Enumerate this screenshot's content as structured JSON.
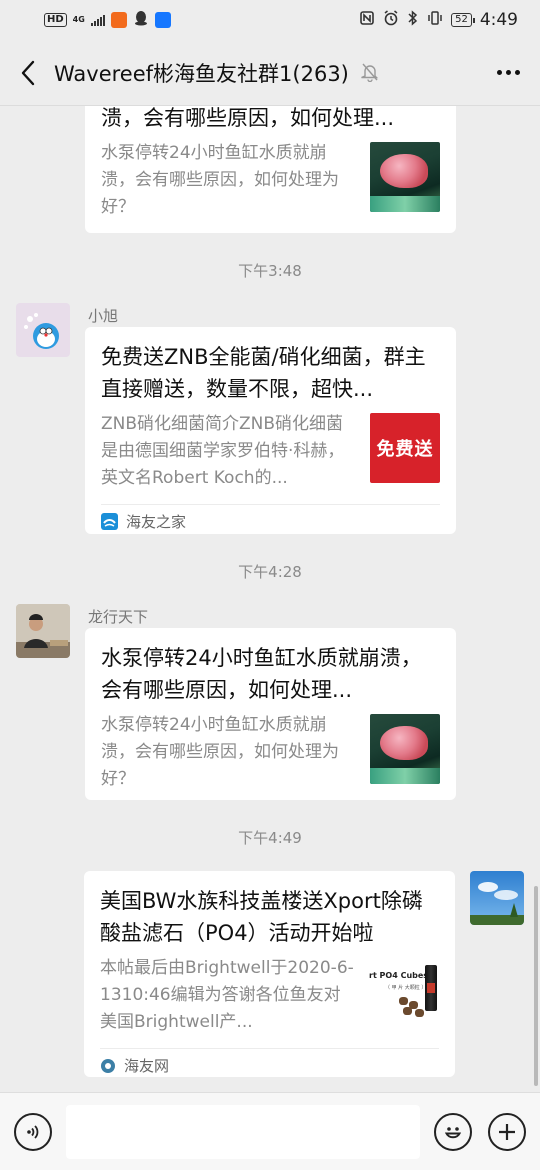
{
  "status_bar": {
    "network_badge": "HD",
    "network_type": "4G",
    "battery_level": "52",
    "time": "4:49",
    "icons": [
      "hd-icon",
      "signal-icon",
      "taobao-icon",
      "qq-icon",
      "alipay-icon",
      "nfc-icon",
      "alarm-icon",
      "bluetooth-icon",
      "vibrate-icon",
      "battery-icon"
    ]
  },
  "header": {
    "title": "Wavereef彬海鱼友社群1(263)",
    "muted": true,
    "back_icon": "chevron-left-icon",
    "more_icon": "more-dots-icon"
  },
  "messages": [
    {
      "type": "link_card",
      "title": "溃，会有哪些原因，如何处理...",
      "desc": "水泵停转24小时鱼缸水质就崩溃，会有哪些原因，如何处理为好？",
      "thumb": "fish-thumbnail"
    },
    {
      "type": "timestamp",
      "text": "下午3:48"
    },
    {
      "type": "link_card",
      "sender": "小旭",
      "avatar": "doraemon-avatar",
      "title": "免费送ZNB全能菌/硝化细菌，群主直接赠送，数量不限，超快...",
      "desc": "ZNB硝化细菌简介ZNB硝化细菌是由德国细菌学家罗伯特·科赫，英文名Robert Koch的...",
      "thumb": "free-gift-thumbnail",
      "thumb_text": "免费送",
      "source": "海友之家",
      "source_icon": "haiyouzhijia-icon"
    },
    {
      "type": "timestamp",
      "text": "下午4:28"
    },
    {
      "type": "link_card",
      "sender": "龙行天下",
      "avatar": "man-photo-avatar",
      "title": "水泵停转24小时鱼缸水质就崩溃，会有哪些原因，如何处理...",
      "desc": "水泵停转24小时鱼缸水质就崩溃，会有哪些原因，如何处理为好？",
      "thumb": "fish-thumbnail"
    },
    {
      "type": "timestamp",
      "text": "下午4:49"
    },
    {
      "type": "link_card",
      "sender": "self",
      "avatar": "sky-avatar",
      "title": "美国BW水族科技盖楼送Xport除磷酸盐滤石（PO4）活动开始啦",
      "desc": "本帖最后由Brightwell于2020-6-1310:46编辑为答谢各位鱼友对美国Brightwell产...",
      "thumb": "po4-cubes-thumbnail",
      "thumb_text": "rt PO4 Cubes",
      "thumb_subtext": "（ 甲 片  大颗粒 ）",
      "source": "海友网",
      "source_icon": "haiyouwang-icon"
    }
  ],
  "input_bar": {
    "voice_icon": "voice-icon",
    "input_value": "",
    "emoji_icon": "emoji-icon",
    "plus_icon": "plus-icon"
  }
}
